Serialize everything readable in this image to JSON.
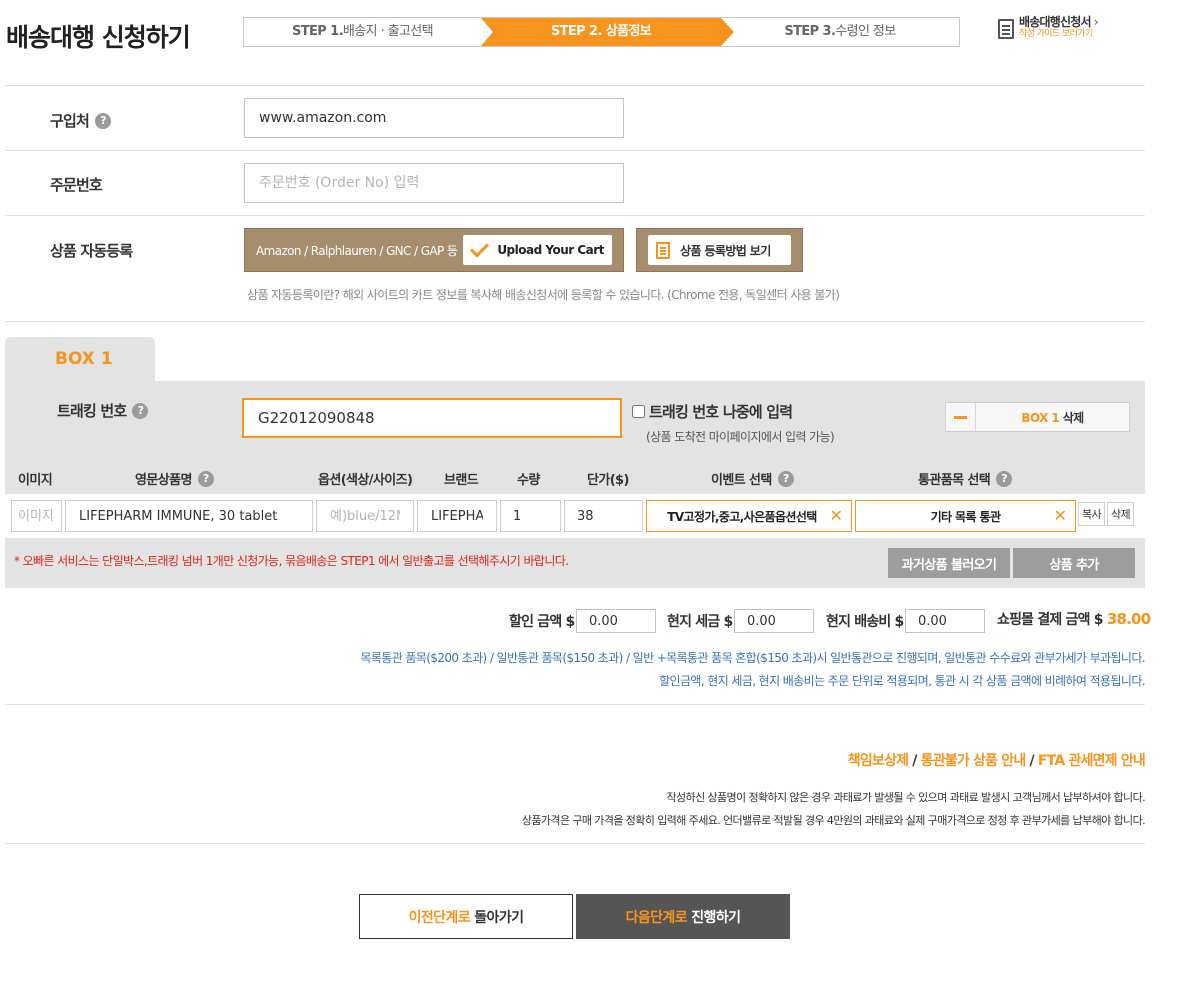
{
  "header": {
    "title": "배송대행 신청하기",
    "steps": [
      {
        "num": "STEP 1.",
        "label": "배송지 · 출고선택"
      },
      {
        "num": "STEP 2.",
        "label": "상품정보"
      },
      {
        "num": "STEP 3.",
        "label": "수령인 정보"
      }
    ],
    "guide_title": "배송대행신청서",
    "guide_chevron": "›",
    "guide_sub": "작성 가이드 보러가기"
  },
  "form": {
    "store_label": "구입처",
    "store_value": "www.amazon.com",
    "order_label": "주문번호",
    "order_placeholder": "주문번호 (Order No) 입력",
    "auto_label": "상품 자동등록",
    "auto_button_text": "Amazon / Ralphlauren / GNC / GAP 등",
    "upload_label": "Upload Your Cart",
    "howto_label": "상품 등록방법 보기",
    "auto_note": "상품 자동등록이란? 해외 사이트의 카트 정보를 복사해 배송신청서에 등록할 수 있습니다. (Chrome 전용, 독일센터 사용 불가)"
  },
  "box": {
    "tab_label": "BOX 1",
    "tracking_label": "트래킹 번호",
    "tracking_value": "G22012090848",
    "later_label": "트래킹 번호 나중에 입력",
    "later_note": "(상품 도착전 마이페이지에서 입력 가능)",
    "delete_prefix": "BOX 1",
    "delete_suffix": "삭제",
    "columns": [
      "이미지",
      "영문상품명",
      "옵션(색상/사이즈)",
      "브랜드",
      "수량",
      "단가($)",
      "이벤트 선택",
      "통관품목 선택"
    ],
    "row": {
      "image_placeholder": "이미지",
      "product_name": "LIFEPHARM IMMUNE, 30 tablet",
      "option_placeholder": "예)blue/12M",
      "brand": "LIFEPHA",
      "qty": "1",
      "price": "38",
      "event": "TV고정가,중고,사은품옵션선택",
      "customs": "기타 목록 통관",
      "copy_label": "복사",
      "delete_label": "삭제"
    },
    "red_note": "* 오빠른 서비스는 단일박스,트래킹 넘버 1개만 신청가능, 묶음배송은 STEP1 에서 일반출고를 선택해주시기 바랍니다.",
    "load_past_label": "과거상품 불러오기",
    "add_product_label": "상품 추가"
  },
  "totals": {
    "discount_label": "할인 금액 $",
    "discount_value": "0.00",
    "tax_label": "현지 세금 $",
    "tax_value": "0.00",
    "shipping_label": "현지 배송비 $",
    "shipping_value": "0.00",
    "total_label": "쇼핑몰 결제 금액 $",
    "total_value": "38.00",
    "note1": "목록통관 품목($200 초과) / 일반통관 품목($150 초과) / 일반 +목록통관 품목 혼합($150 초과)시 일반통관으로 진행되며, 일반통관 수수료와 관부가세가 부과됩니다.",
    "note2": "할인금액, 현지 세금, 현지 배송비는 주문 단위로 적용되며, 통관 시 각 상품 금액에 비례하여 적용됩니다."
  },
  "info": {
    "link1": "책임보상제",
    "sep": " / ",
    "link2": "통관불가 상품 안내",
    "link3": "FTA 관세면제 안내",
    "note1": "작성하신 상품명이 정확하지 않은 경우 과태료가 발생될 수 있으며 과태료 발생시 고객님께서 납부하셔야 합니다.",
    "note2": "상품가격은 구매 가격을 정확히 입력해 주세요. 언더밸류로 적발될 경우 4만원의 과태료와 실제 구매가격으로 정정 후 관부가세를 납부해야 합니다."
  },
  "nav": {
    "prev_highlight": "이전단계로",
    "prev_rest": " 돌아가기",
    "next_highlight": "다음단계로",
    "next_rest": " 진행하기"
  },
  "icons": {
    "help": "question-circle-icon",
    "check": "check-icon",
    "doc": "document-icon",
    "minus": "minus-icon",
    "close": "close-x-icon"
  },
  "colors": {
    "accent": "#f7941d",
    "brown": "#a58d6e",
    "red": "#e0261b",
    "blue": "#3a73b8",
    "gray_button": "#9d9d9d",
    "dark_button": "#555555"
  }
}
